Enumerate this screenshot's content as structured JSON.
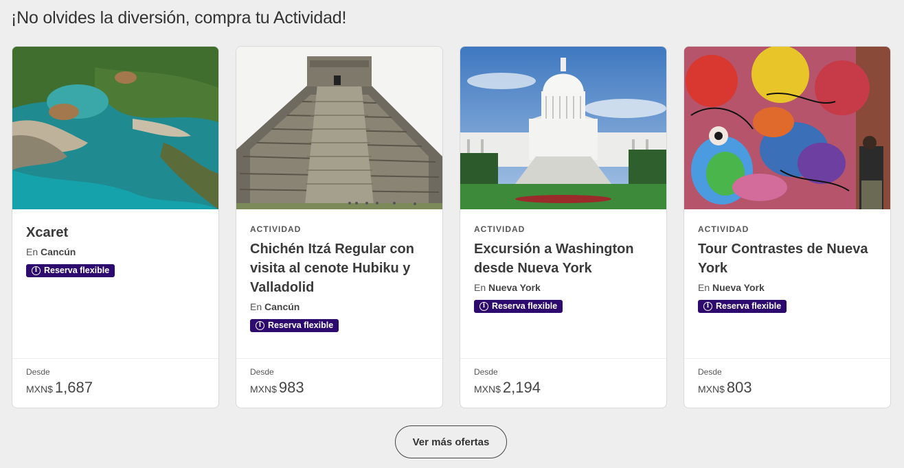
{
  "section": {
    "title": "¡No olvides la diversión, compra tu Actividad!"
  },
  "cards": [
    {
      "kicker": "",
      "name": "Xcaret",
      "loc_prefix": "En",
      "location": "Cancún",
      "badge": "Reserva flexible",
      "from_label": "Desde",
      "currency": "MXN$",
      "price": "1,687",
      "image": "aerial-lagoon"
    },
    {
      "kicker": "ACTIVIDAD",
      "name": "Chichén Itzá Regular con visita al cenote Hubiku y Valladolid",
      "loc_prefix": "En",
      "location": "Cancún",
      "badge": "Reserva flexible",
      "from_label": "Desde",
      "currency": "MXN$",
      "price": "983",
      "image": "pyramid"
    },
    {
      "kicker": "ACTIVIDAD",
      "name": "Excursión a Washington desde Nueva York",
      "loc_prefix": "En",
      "location": "Nueva York",
      "badge": "Reserva flexible",
      "from_label": "Desde",
      "currency": "MXN$",
      "price": "2,194",
      "image": "capitol"
    },
    {
      "kicker": "ACTIVIDAD",
      "name": "Tour Contrastes de Nueva York",
      "loc_prefix": "En",
      "location": "Nueva York",
      "badge": "Reserva flexible",
      "from_label": "Desde",
      "currency": "MXN$",
      "price": "803",
      "image": "graffiti-wall"
    }
  ],
  "more_button": {
    "label": "Ver más ofertas"
  },
  "colors": {
    "badge_bg": "#2d0a6e",
    "page_bg": "#eeeeee"
  }
}
